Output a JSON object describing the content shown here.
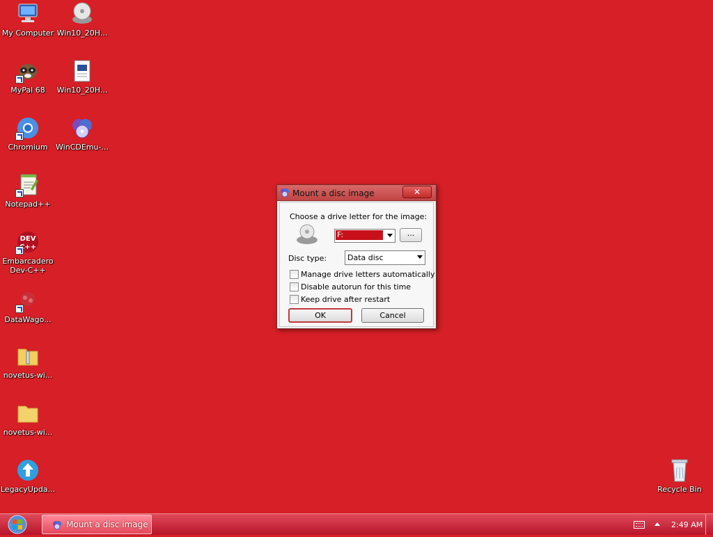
{
  "desktop": {
    "background_color": "#d61f26",
    "icons": [
      {
        "label": "My Computer",
        "icon": "computer-icon"
      },
      {
        "label": "Win10_20H...",
        "icon": "disc-drive-icon"
      },
      {
        "label": "MyPal 68",
        "icon": "raccoon-icon"
      },
      {
        "label": "Win10_20H...",
        "icon": "document-icon"
      },
      {
        "label": "Chromium",
        "icon": "chromium-icon"
      },
      {
        "label": "WinCDEmu-...",
        "icon": "wincdemu-icon"
      },
      {
        "label": "Notepad++",
        "icon": "notepadpp-icon"
      },
      {
        "label": "Embarcadero Dev-C++",
        "icon": "devcpp-icon"
      },
      {
        "label": "DataWago...",
        "icon": "datawagon-icon"
      },
      {
        "label": "novetus-wi...",
        "icon": "zip-folder-icon"
      },
      {
        "label": "novetus-wi...",
        "icon": "folder-icon"
      },
      {
        "label": "LegacyUpda...",
        "icon": "update-icon"
      },
      {
        "label": "Recycle Bin",
        "icon": "recycle-bin-icon"
      }
    ]
  },
  "dialog": {
    "title": "Mount a disc image",
    "close_label": "✕",
    "drive_prompt": "Choose a drive letter for the image:",
    "drive_value": "F:",
    "browse_label": "...",
    "disc_type_label": "Disc type:",
    "disc_type_value": "Data disc",
    "checkboxes": [
      {
        "label": "Manage drive letters automatically",
        "checked": false
      },
      {
        "label": "Disable autorun for this time",
        "checked": false
      },
      {
        "label": "Keep drive after restart",
        "checked": false
      }
    ],
    "ok_label": "OK",
    "cancel_label": "Cancel"
  },
  "taskbar": {
    "items": [
      {
        "label": "Mount a disc image"
      }
    ],
    "clock": "2:49 AM",
    "accent": "#e04a5a"
  }
}
